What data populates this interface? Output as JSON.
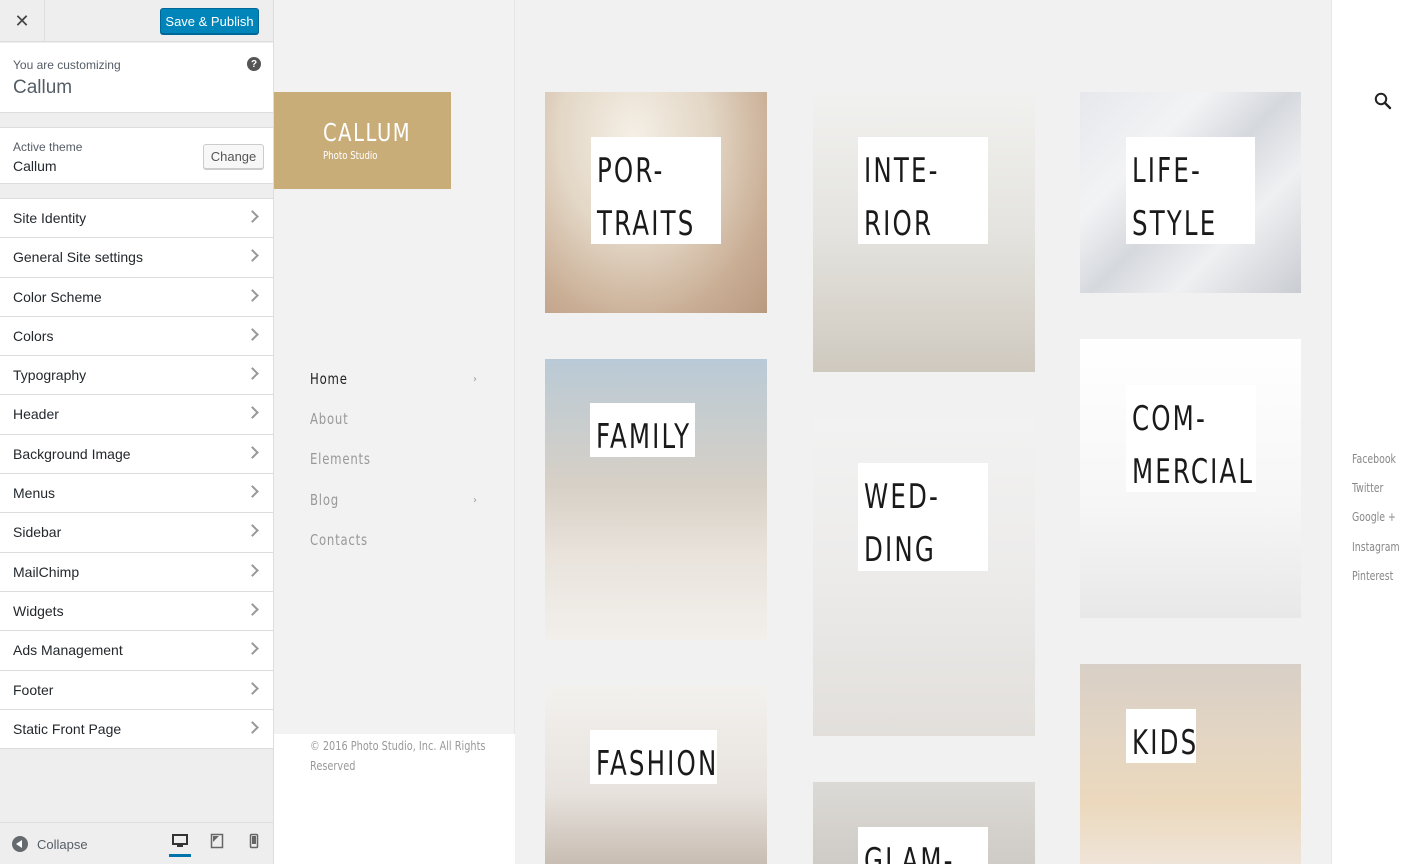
{
  "customizer": {
    "publish_label": "Save & Publish",
    "customizing_label": "You are customizing",
    "site_name": "Callum",
    "active_theme_label": "Active theme",
    "theme_name": "Callum",
    "change_label": "Change",
    "sections": [
      "Site Identity",
      "General Site settings",
      "Color Scheme",
      "Colors",
      "Typography",
      "Header",
      "Background Image",
      "Menus",
      "Sidebar",
      "MailChimp",
      "Widgets",
      "Ads Management",
      "Footer",
      "Static Front Page"
    ],
    "collapse_label": "Collapse",
    "active_device": "desktop"
  },
  "site": {
    "logo_title": "CALLUM",
    "logo_subtitle": "Photo Studio",
    "brand_color": "#c9ad79",
    "nav": [
      {
        "label": "Home",
        "active": true,
        "has_children": true
      },
      {
        "label": "About",
        "active": false,
        "has_children": false
      },
      {
        "label": "Elements",
        "active": false,
        "has_children": false
      },
      {
        "label": "Blog",
        "active": false,
        "has_children": true
      },
      {
        "label": "Contacts",
        "active": false,
        "has_children": false
      }
    ],
    "copyright": "© 2016 Photo Studio, Inc. All Rights Reserved"
  },
  "gallery": [
    {
      "name": "portraits",
      "lines": [
        "POR-",
        "TRAITS"
      ]
    },
    {
      "name": "interior",
      "lines": [
        "INTE-",
        "RIOR"
      ]
    },
    {
      "name": "lifestyle",
      "lines": [
        "LIFE-",
        "STYLE"
      ]
    },
    {
      "name": "family",
      "lines": [
        "FAMILY"
      ]
    },
    {
      "name": "commercial",
      "lines": [
        "COM-",
        "MERCIAL"
      ]
    },
    {
      "name": "wedding",
      "lines": [
        "WED-",
        "DING"
      ]
    },
    {
      "name": "fashion",
      "lines": [
        "FASHION"
      ]
    },
    {
      "name": "kids",
      "lines": [
        "KIDS"
      ]
    },
    {
      "name": "glamour",
      "lines": [
        "GLAM-"
      ]
    }
  ],
  "social": [
    "Facebook",
    "Twitter",
    "Google +",
    "Instagram",
    "Pinterest"
  ]
}
